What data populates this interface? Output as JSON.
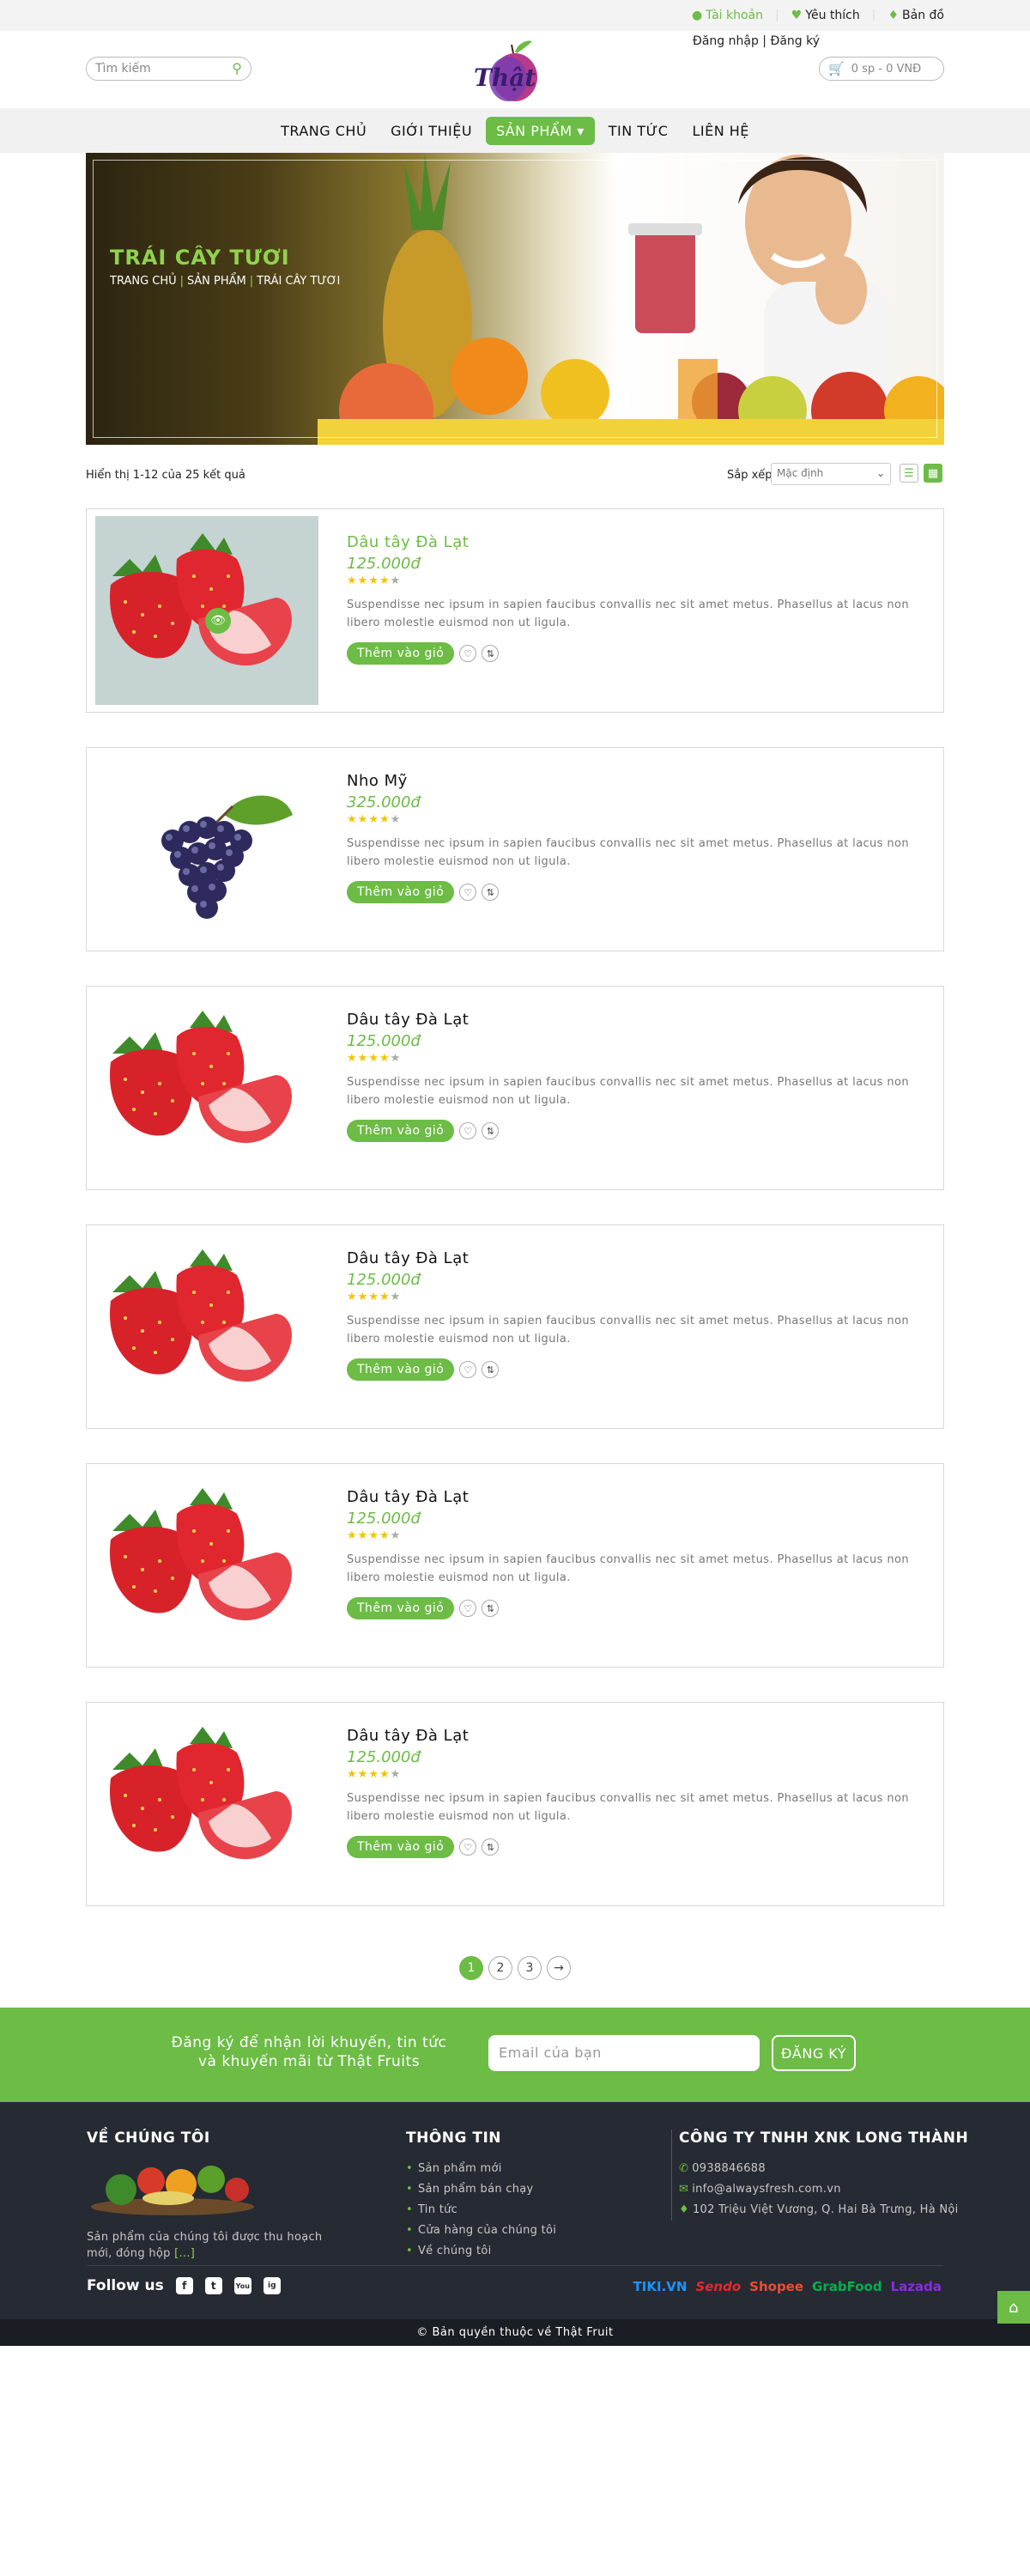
{
  "topbar": {
    "account": "Tài khoản",
    "wishlist": "Yêu thích",
    "map": "Bản đồ",
    "login_register": "Đăng nhập | Đăng ký"
  },
  "header": {
    "search_placeholder": "Tìm kiếm",
    "logo_text": "Thật",
    "cart": "0 sp - 0 VNĐ"
  },
  "nav": {
    "items": [
      "TRANG CHỦ",
      "GIỚI THIỆU",
      "SẢN PHẨM",
      "TIN TỨC",
      "LIÊN HỆ"
    ],
    "active_index": 2
  },
  "banner": {
    "title": "TRÁI CÂY TƯƠI",
    "breadcrumb": [
      "TRANG CHỦ",
      "SẢN PHẨM",
      "TRÁI CÂY TƯƠI"
    ]
  },
  "toolbar": {
    "result_count": "Hiển thị 1-12 của 25 kết quả",
    "sort_label": "Sắp xếp",
    "sort_value": "Mặc định"
  },
  "products": [
    {
      "name": "Dâu tây Đà Lạt",
      "price": "125.000đ",
      "rating": 4,
      "desc": "Suspendisse nec ipsum in sapien faucibus convallis nec sit amet metus. Phasellus at lacus non libero molestie euismod non ut ligula.",
      "add_label": "Thêm vào giỏ",
      "image": "strawberry",
      "highlight": true
    },
    {
      "name": "Nho Mỹ",
      "price": "325.000đ",
      "rating": 4,
      "desc": "Suspendisse nec ipsum in sapien faucibus convallis nec sit amet metus. Phasellus at lacus non libero molestie euismod non ut ligula.",
      "add_label": "Thêm vào giỏ",
      "image": "grape",
      "highlight": false
    },
    {
      "name": "Dâu tây Đà Lạt",
      "price": "125.000đ",
      "rating": 4,
      "desc": "Suspendisse nec ipsum in sapien faucibus convallis nec sit amet metus. Phasellus at lacus non libero molestie euismod non ut ligula.",
      "add_label": "Thêm vào giỏ",
      "image": "strawberry",
      "highlight": false
    },
    {
      "name": "Dâu tây Đà Lạt",
      "price": "125.000đ",
      "rating": 4,
      "desc": "Suspendisse nec ipsum in sapien faucibus convallis nec sit amet metus. Phasellus at lacus non libero molestie euismod non ut ligula.",
      "add_label": "Thêm vào giỏ",
      "image": "strawberry",
      "highlight": false
    },
    {
      "name": "Dâu tây Đà Lạt",
      "price": "125.000đ",
      "rating": 4,
      "desc": "Suspendisse nec ipsum in sapien faucibus convallis nec sit amet metus. Phasellus at lacus non libero molestie euismod non ut ligula.",
      "add_label": "Thêm vào giỏ",
      "image": "strawberry",
      "highlight": false
    },
    {
      "name": "Dâu tây Đà Lạt",
      "price": "125.000đ",
      "rating": 4,
      "desc": "Suspendisse nec ipsum in sapien faucibus convallis nec sit amet metus. Phasellus at lacus non libero molestie euismod non ut ligula.",
      "add_label": "Thêm vào giỏ",
      "image": "strawberry",
      "highlight": false
    }
  ],
  "pagination": {
    "pages": [
      "1",
      "2",
      "3"
    ],
    "next": "→",
    "active": "1"
  },
  "newsletter": {
    "text_line1": "Đăng ký để nhận lời khuyến, tin tức",
    "text_line2": "và khuyến mãi từ Thật Fruits",
    "email_placeholder": "Email của bạn",
    "button": "ĐĂNG KÝ"
  },
  "footer": {
    "about_title": "VỀ CHÚNG TÔI",
    "about_text": "Sản phẩm của chúng tôi được thu hoạch mới, đóng hộp",
    "about_more": "[...]",
    "info_title": "THÔNG TIN",
    "info_links": [
      "Sản phẩm mới",
      "Sản phẩm bán chạy",
      "Tin tức",
      "Cửa hàng của chúng tôi",
      "Về chúng tôi"
    ],
    "company_title": "CÔNG TY TNHH XNK LONG THÀNH",
    "phone": "0938846688",
    "email": "info@alwaysfresh.com.vn",
    "address": "102 Triệu Việt Vương, Q. Hai Bà Trưng, Hà Nội",
    "follow_label": "Follow us",
    "social": [
      "f",
      "t",
      "You",
      "ig"
    ],
    "partners": [
      "TIKI.VN",
      "Sendo",
      "Shopee",
      "GrabFood",
      "Lazada"
    ]
  },
  "copyright": "© Bản quyền thuộc về Thật Fruit",
  "colors": {
    "accent": "#6cbc45",
    "footer_bg": "#262a33"
  }
}
